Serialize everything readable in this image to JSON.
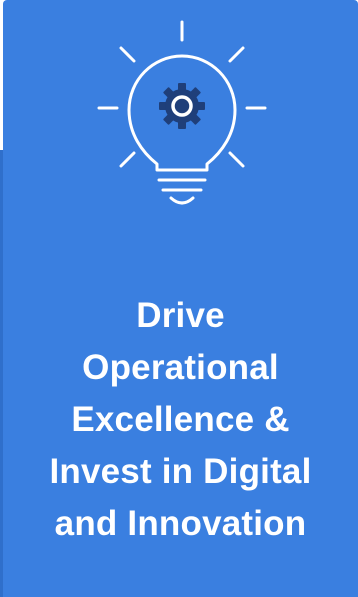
{
  "card": {
    "background_color": "#3a7fe0",
    "icon": "lightbulb-gear-icon",
    "title_lines": [
      "Drive",
      "Operational",
      "Excellence &",
      "Invest in Digital",
      "and Innovation"
    ]
  }
}
